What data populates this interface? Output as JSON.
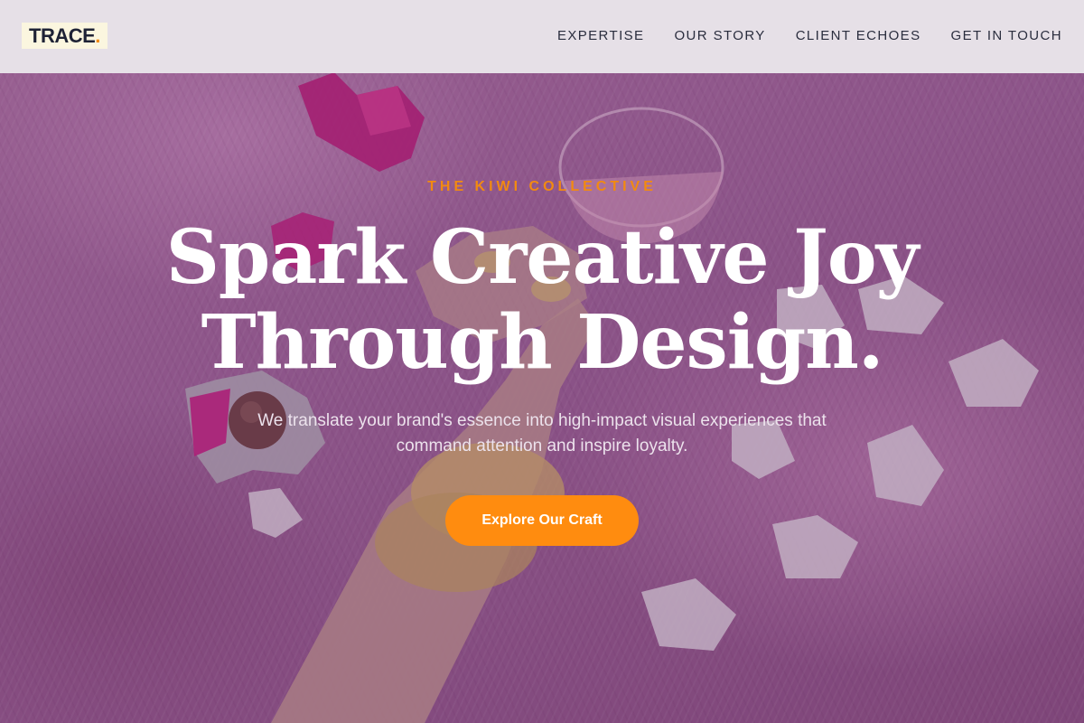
{
  "brand": {
    "logo_text": "TRACE",
    "logo_dot": ".",
    "accent_color": "#f28a10",
    "logo_bg": "#fbf6df"
  },
  "nav": {
    "items": [
      {
        "label": "EXPERTISE"
      },
      {
        "label": "OUR STORY"
      },
      {
        "label": "CLIENT ECHOES"
      },
      {
        "label": "GET IN TOUCH"
      }
    ]
  },
  "hero": {
    "eyebrow": "THE KIWI COLLECTIVE",
    "headline_line1": "Spark Creative Joy",
    "headline_line2": "Through Design.",
    "subtext": "We translate your brand's essence into high-impact visual experiences that command attention and inspire loyalty.",
    "cta_label": "Explore Our Craft",
    "cta_color": "#ff8c0f",
    "background_icon": "hero-photo"
  }
}
